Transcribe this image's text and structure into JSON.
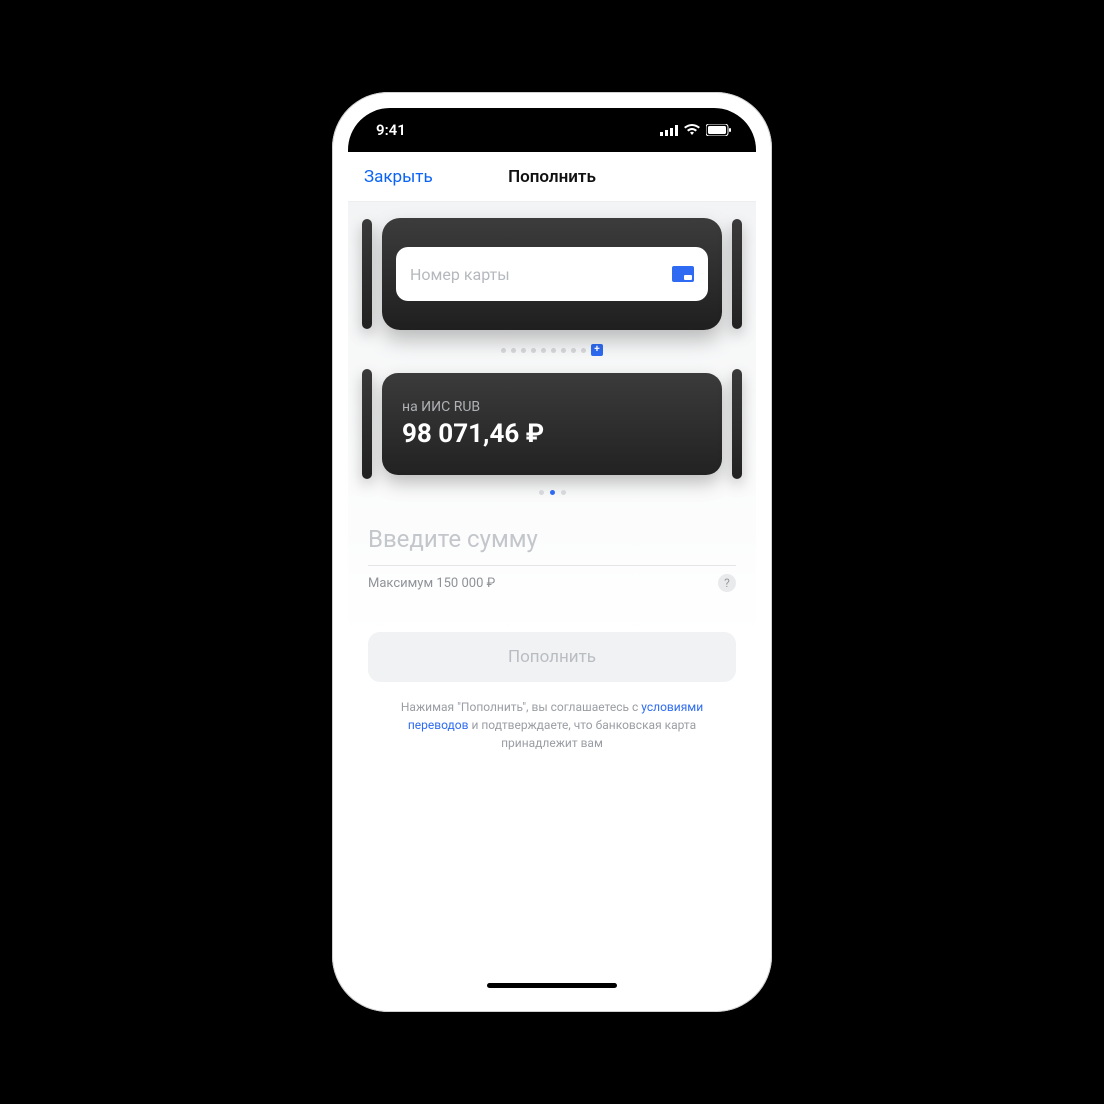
{
  "statusBar": {
    "time": "9:41"
  },
  "nav": {
    "close": "Закрыть",
    "title": "Пополнить"
  },
  "cardInput": {
    "placeholder": "Номер карты"
  },
  "account": {
    "label": "на ИИС RUB",
    "balance": "98 071,46 ₽"
  },
  "amount": {
    "placeholder": "Введите сумму",
    "limit": "Максимум 150 000 ₽"
  },
  "submit": {
    "label": "Пополнить"
  },
  "disclaimer": {
    "part1": "Нажимая \"Пополнить\", вы соглашаетесь с ",
    "link": "условиями переводов",
    "part2": " и подтверждаете, что банковская карта принадлежит вам"
  }
}
